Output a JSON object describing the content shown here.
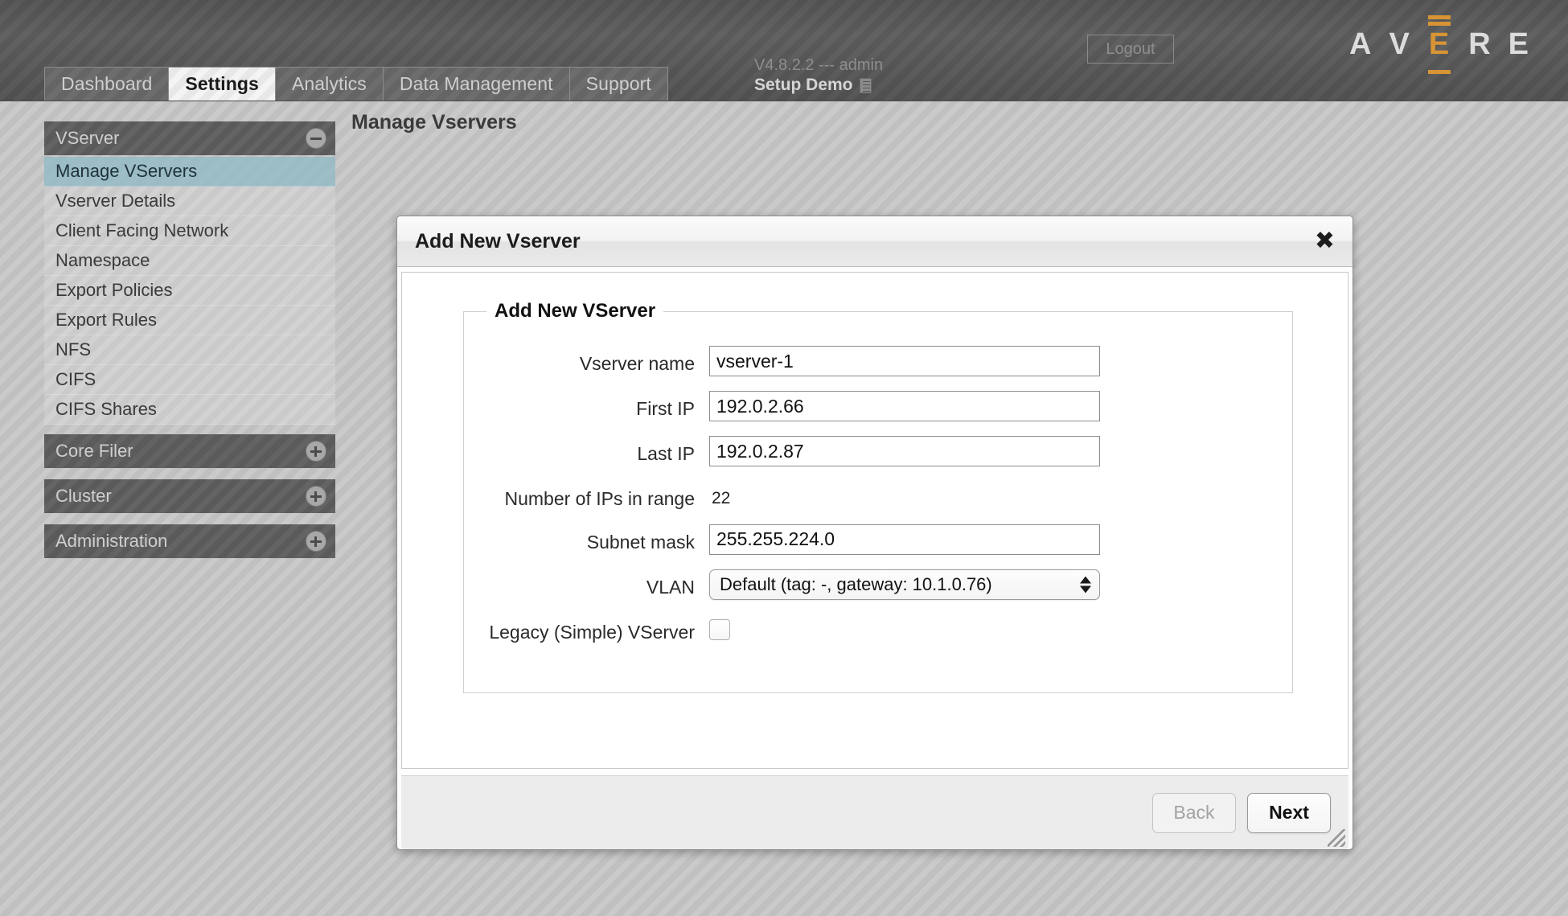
{
  "header": {
    "tabs": [
      {
        "label": "Dashboard",
        "active": false
      },
      {
        "label": "Settings",
        "active": true
      },
      {
        "label": "Analytics",
        "active": false
      },
      {
        "label": "Data Management",
        "active": false
      },
      {
        "label": "Support",
        "active": false
      }
    ],
    "version_line": "V4.8.2.2 --- admin",
    "setup_label": "Setup Demo",
    "logout_label": "Logout",
    "logo": {
      "part1": "A",
      "part2": "V",
      "part3": "E",
      "part4": "R",
      "part5": "E",
      "accent_color": "#d79434"
    }
  },
  "sidebar": {
    "sections": [
      {
        "title": "VServer",
        "toggle": "minus",
        "items": [
          {
            "label": "Manage VServers",
            "selected": true
          },
          {
            "label": "Vserver Details",
            "selected": false
          },
          {
            "label": "Client Facing Network",
            "selected": false
          },
          {
            "label": "Namespace",
            "selected": false
          },
          {
            "label": "Export Policies",
            "selected": false
          },
          {
            "label": "Export Rules",
            "selected": false
          },
          {
            "label": "NFS",
            "selected": false
          },
          {
            "label": "CIFS",
            "selected": false
          },
          {
            "label": "CIFS Shares",
            "selected": false
          }
        ]
      },
      {
        "title": "Core Filer",
        "toggle": "plus",
        "items": []
      },
      {
        "title": "Cluster",
        "toggle": "plus",
        "items": []
      },
      {
        "title": "Administration",
        "toggle": "plus",
        "items": []
      }
    ]
  },
  "page": {
    "title": "Manage Vservers"
  },
  "modal": {
    "title": "Add New Vserver",
    "close_label": "✖",
    "legend": "Add New VServer",
    "fields": {
      "vserver_name": {
        "label": "Vserver name",
        "value": "vserver-1"
      },
      "first_ip": {
        "label": "First IP",
        "value": "192.0.2.66"
      },
      "last_ip": {
        "label": "Last IP",
        "value": "192.0.2.87"
      },
      "num_ips": {
        "label": "Number of IPs in range",
        "value": "22"
      },
      "subnet_mask": {
        "label": "Subnet mask",
        "value": "255.255.224.0"
      },
      "vlan": {
        "label": "VLAN",
        "value": "Default (tag: -, gateway: 10.1.0.76)",
        "options": [
          "Default (tag: -, gateway: 10.1.0.76)"
        ]
      },
      "legacy": {
        "label": "Legacy (Simple) VServer",
        "checked": false
      }
    },
    "buttons": {
      "back": "Back",
      "next": "Next"
    }
  }
}
